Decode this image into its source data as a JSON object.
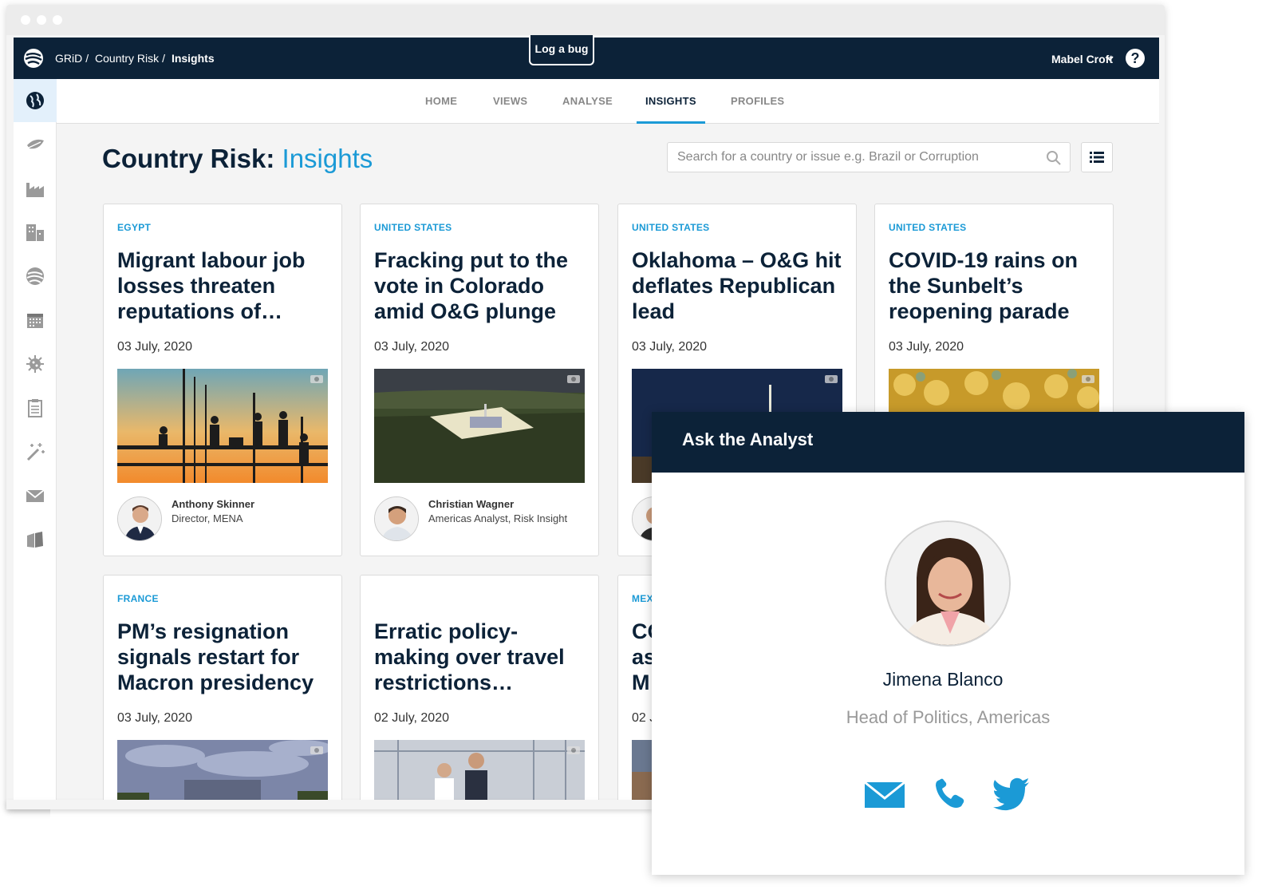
{
  "topbar": {
    "breadcrumb": [
      "GRiD",
      "Country Risk",
      "Insights"
    ],
    "log_bug": "Log a bug",
    "user": "Mabel Croft",
    "help": "?"
  },
  "tabs": [
    "HOME",
    "VIEWS",
    "ANALYSE",
    "INSIGHTS",
    "PROFILES"
  ],
  "active_tab": "INSIGHTS",
  "page": {
    "title": "Country Risk:",
    "title_accent": "Insights",
    "search_placeholder": "Search for a country or issue e.g. Brazil or Corruption"
  },
  "sidebar_icons": [
    "globe-icon",
    "leaf-icon",
    "factory-icon",
    "buildings-icon",
    "logo-globe-icon",
    "calendar-icon",
    "virus-icon",
    "clipboard-icon",
    "magic-wand-icon",
    "mail-icon",
    "books-icon"
  ],
  "cards": [
    {
      "country": "EGYPT",
      "headline": "Migrant labour job losses threaten reputations of…",
      "date": "03 July, 2020",
      "author": "Anthony Skinner",
      "role": "Director, MENA"
    },
    {
      "country": "UNITED STATES",
      "headline": "Fracking put to the vote in Colorado amid O&G plunge",
      "date": "03 July, 2020",
      "author": "Christian Wagner",
      "role": "Americas Analyst, Risk Insight"
    },
    {
      "country": "UNITED STATES",
      "headline": "Oklahoma – O&G hit deflates Republican lead",
      "date": "03 July, 2020",
      "author": "",
      "role": ""
    },
    {
      "country": "UNITED STATES",
      "headline": "COVID-19 rains on the Sunbelt’s reopening parade",
      "date": "03 July, 2020",
      "author": "",
      "role": ""
    },
    {
      "country": "FRANCE",
      "headline": "PM’s resignation signals restart for Macron presidency",
      "date": "03 July, 2020",
      "author": "",
      "role": ""
    },
    {
      "country": "",
      "headline": "Erratic policy-making over travel restrictions…",
      "date": "02 July, 2020",
      "author": "",
      "role": ""
    },
    {
      "country": "MEX",
      "headline": "CO as M",
      "date": "02 J",
      "author": "",
      "role": ""
    }
  ],
  "ask_analyst": {
    "title": "Ask the Analyst",
    "name": "Jimena Blanco",
    "role": "Head of Politics, Americas",
    "contact_icons": [
      "mail-icon",
      "phone-icon",
      "twitter-icon"
    ],
    "accent_color": "#1b9ad6"
  },
  "colors": {
    "navy": "#0c2238",
    "accent": "#1b9ad6"
  }
}
